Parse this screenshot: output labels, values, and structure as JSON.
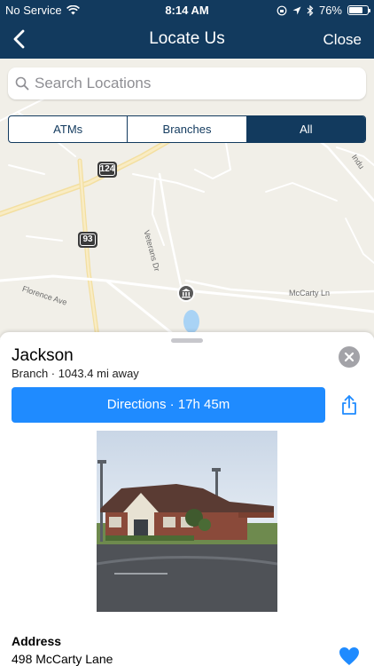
{
  "status_bar": {
    "carrier": "No Service",
    "time": "8:14 AM",
    "battery": "76%",
    "battery_level": 0.76
  },
  "nav": {
    "title": "Locate Us",
    "close_label": "Close"
  },
  "search": {
    "placeholder": "Search Locations"
  },
  "filter": {
    "options": [
      "ATMs",
      "Branches",
      "All"
    ],
    "selected": "All"
  },
  "map": {
    "route_shields": [
      "124",
      "93"
    ],
    "street_labels": [
      "Veterans Dr",
      "McCarty Ln",
      "Florence Ave",
      "Indu"
    ]
  },
  "location": {
    "name": "Jackson",
    "subtitle": "Branch · 1043.4 mi away",
    "directions_label": "Directions · 17h 45m",
    "address_label": "Address",
    "address_value": "498 McCarty Lane"
  },
  "icons": {
    "back": "chevron-left-icon",
    "search": "magnifier-icon",
    "close": "x-icon",
    "share": "share-icon",
    "favorite": "heart-icon",
    "bank": "bank-icon"
  },
  "colors": {
    "nav_background": "#123a5e",
    "accent": "#1f8bff",
    "map_background": "#f1efe8"
  }
}
